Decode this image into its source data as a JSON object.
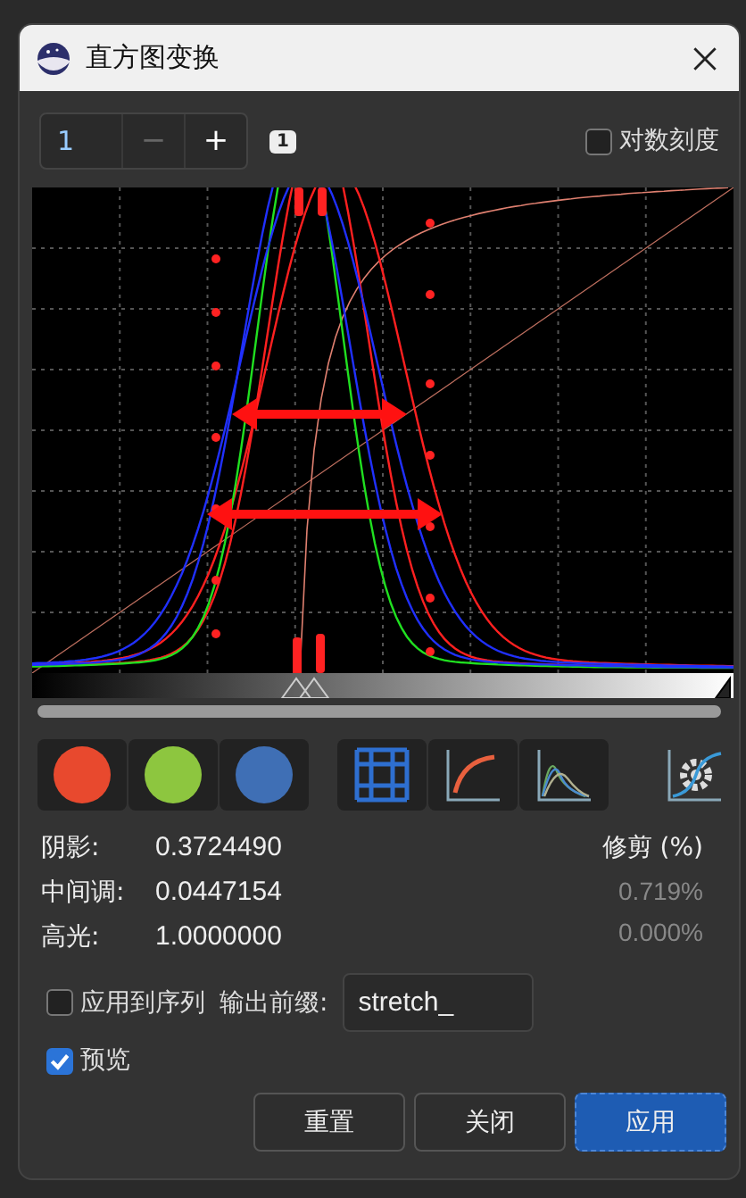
{
  "window": {
    "title": "直方图变换"
  },
  "layer_spinner": {
    "value": "1",
    "decrement": "−",
    "increment": "+"
  },
  "layer_badge": "1",
  "log_scale": {
    "label": "对数刻度",
    "checked": false
  },
  "channels": [
    {
      "color": "#e8492e"
    },
    {
      "color": "#8dc63f"
    },
    {
      "color": "#3f6fb5"
    }
  ],
  "view_toggles": [
    {
      "kind": "grid"
    },
    {
      "kind": "curve"
    },
    {
      "kind": "histograms"
    }
  ],
  "auto_stretch": {
    "kind": "auto"
  },
  "values": [
    {
      "label": "阴影:",
      "value": "0.3724490"
    },
    {
      "label": "中间调:",
      "value": "0.0447154"
    },
    {
      "label": "高光:",
      "value": "1.0000000"
    }
  ],
  "clipping": {
    "title": "修剪 (%)",
    "values": [
      "0.719%",
      "0.000%"
    ]
  },
  "apply_to_sequence": {
    "label": "应用到序列",
    "checked": false
  },
  "output_prefix": {
    "label": "输出前缀:",
    "value": "stretch_"
  },
  "preview": {
    "label": "预览",
    "checked": true
  },
  "buttons": [
    {
      "label": "重置",
      "kind": "normal"
    },
    {
      "label": "关闭",
      "kind": "normal"
    },
    {
      "label": "应用",
      "kind": "primary"
    }
  ]
}
